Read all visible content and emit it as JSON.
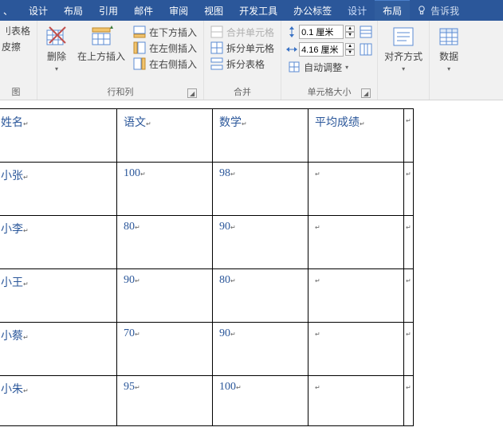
{
  "tabs": {
    "design1": "设计",
    "layout1": "布局",
    "references": "引用",
    "mail": "邮件",
    "review": "审阅",
    "view": "视图",
    "devtools": "开发工具",
    "officetab": "办公标签",
    "design2": "设计",
    "layout2": "布局",
    "tellme": "告诉我"
  },
  "ribbon": {
    "view_group_label": "图",
    "draw_table": "刂表格",
    "eraser": "皮擦",
    "delete": "删除",
    "insert_above": "在上方插入",
    "rows_cols_label": "行和列",
    "insert_below": "在下方插入",
    "insert_left": "在左侧插入",
    "insert_right": "在右侧插入",
    "merge_cells": "合并单元格",
    "split_cells": "拆分单元格",
    "split_table": "拆分表格",
    "merge_label": "合并",
    "height_value": "0.1 厘米",
    "width_value": "4.16 厘米",
    "autofit": "自动调整",
    "cellsize_label": "单元格大小",
    "align": "对齐方式",
    "data": "数据"
  },
  "table": {
    "headers": {
      "name": "姓名",
      "chinese": "语文",
      "math": "数学",
      "avg": "平均成绩"
    },
    "rows": [
      {
        "name": "小张",
        "chinese": "100",
        "math": "98",
        "avg": ""
      },
      {
        "name": "小李",
        "chinese": "80",
        "math": "90",
        "avg": ""
      },
      {
        "name": "小王",
        "chinese": "90",
        "math": "80",
        "avg": ""
      },
      {
        "name": "小蔡",
        "chinese": "70",
        "math": "90",
        "avg": ""
      },
      {
        "name": "小朱",
        "chinese": "95",
        "math": "100",
        "avg": ""
      }
    ],
    "pm": "↵"
  }
}
